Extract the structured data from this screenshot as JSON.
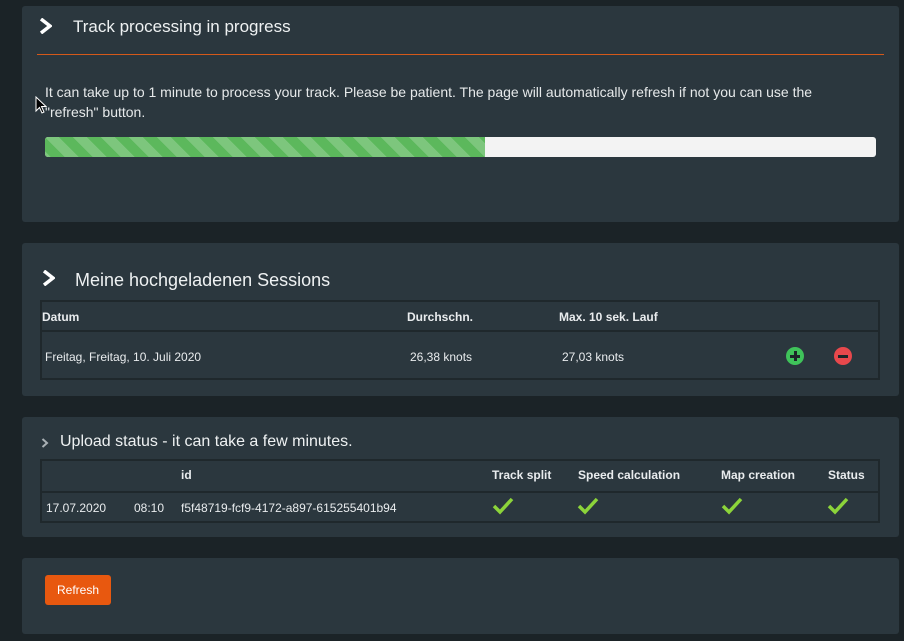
{
  "processing": {
    "title": "Track processing in progress",
    "message": "It can take up to 1 minute to process your track. Please be patient. The page will automatically refresh if not you can use the \"refresh\" button.",
    "progress_fraction": 0.53
  },
  "sessions": {
    "title": "Meine hochgeladenen Sessions",
    "columns": [
      "Datum",
      "Durchschn.",
      "Max. 10 sek. Lauf"
    ],
    "rows": [
      {
        "date": "Freitag, Freitag, 10. Juli 2020",
        "avg": "26,38 knots",
        "max10": "27,03 knots"
      }
    ]
  },
  "upload": {
    "title": "Upload status - it can take a few minutes.",
    "columns": [
      "",
      "",
      "id",
      "Track split",
      "Speed calculation",
      "Map creation",
      "Status"
    ],
    "rows": [
      {
        "date": "17.07.2020",
        "time": "08:10",
        "id": "f5f48719-fcf9-4172-a897-615255401b94"
      }
    ]
  },
  "refresh_label": "Refresh",
  "colors": {
    "accent": "#e8580f",
    "success": "#5cb85c",
    "add": "#3fc35a",
    "remove": "#e8484c",
    "check": "#8cd43a"
  }
}
